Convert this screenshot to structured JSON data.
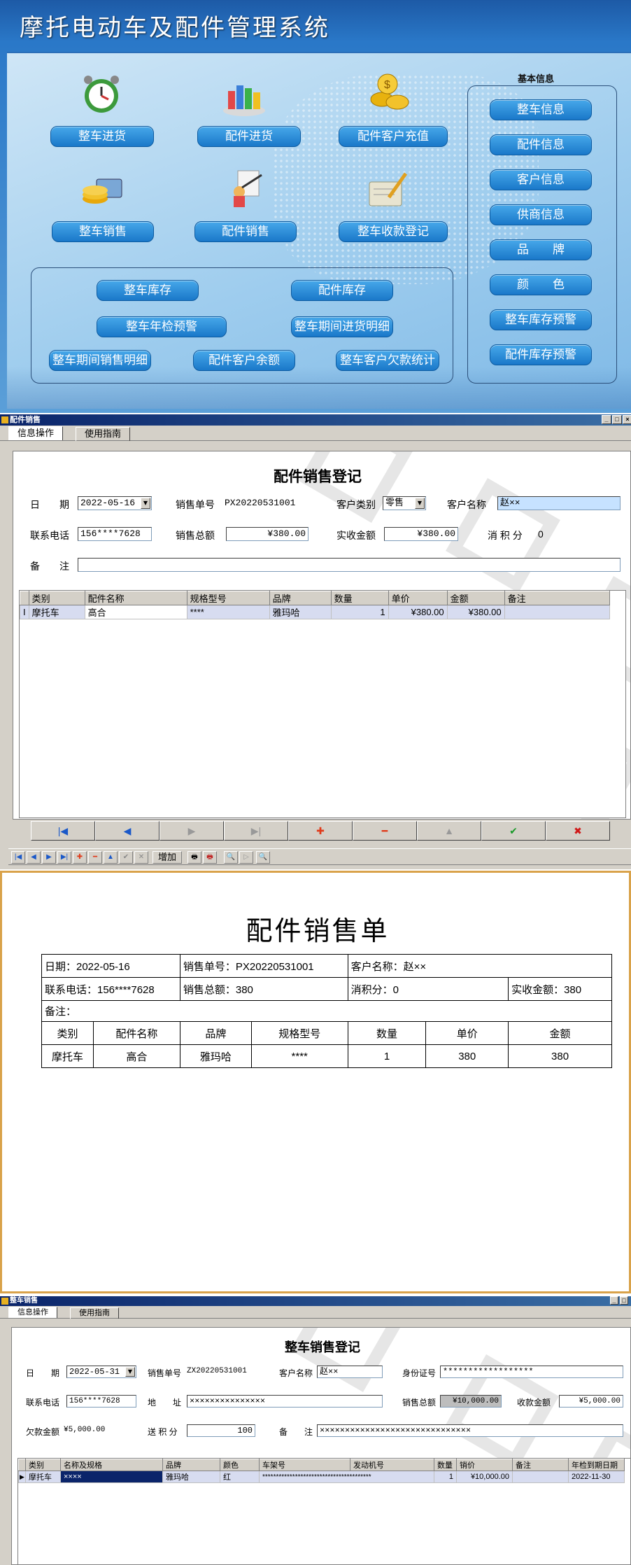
{
  "main": {
    "title": "摩托电动车及配件管理系统",
    "buttons": {
      "vehicle_purchase": "整车进货",
      "parts_purchase": "配件进货",
      "parts_customer_topup": "配件客户充值",
      "vehicle_sales": "整车销售",
      "parts_sales": "配件销售",
      "vehicle_payment": "整车收款登记",
      "vehicle_stock": "整车库存",
      "parts_stock": "配件库存",
      "vehicle_inspection_alert": "整车年检预警",
      "vehicle_period_purchase": "整车期间进货明细",
      "vehicle_period_sales": "整车期间销售明细",
      "parts_customer_balance": "配件客户余额",
      "vehicle_customer_debt": "整车客户欠款统计"
    },
    "basic_info": {
      "title": "基本信息",
      "items": [
        "整车信息",
        "配件信息",
        "客户信息",
        "供商信息",
        "品　　牌",
        "颜　　色",
        "整车库存预警",
        "配件库存预警"
      ]
    }
  },
  "parts_window": {
    "title": "配件销售",
    "tabs": [
      "信息操作",
      "使用指南"
    ],
    "form_title": "配件销售登记",
    "labels": {
      "date": "日　　期",
      "sale_no": "销售单号",
      "customer_type": "客户类别",
      "customer_name": "客户名称",
      "phone": "联系电话",
      "total": "销售总额",
      "received": "实收金额",
      "points": "消 积 分",
      "remark": "备　　注"
    },
    "values": {
      "date": "2022-05-16",
      "sale_no": "PX20220531001",
      "customer_type": "零售",
      "customer_name": "赵××",
      "phone": "156****7628",
      "total": "¥380.00",
      "received": "¥380.00",
      "points": "0",
      "remark": ""
    },
    "grid_headers": [
      "类别",
      "配件名称",
      "规格型号",
      "品牌",
      "数量",
      "单价",
      "金额",
      "备注"
    ],
    "grid_rows": [
      [
        "摩托车",
        "高合",
        "****",
        "雅玛哈",
        "1",
        "¥380.00",
        "¥380.00",
        ""
      ]
    ],
    "row_indicator": "I",
    "nav_icons": [
      "first-icon",
      "prior-icon",
      "next-icon",
      "last-icon",
      "insert-icon",
      "delete-icon",
      "edit-icon",
      "post-icon",
      "cancel-icon"
    ],
    "toolbar_add": "增加"
  },
  "report": {
    "title": "配件销售单",
    "date": "日期：2022-05-16",
    "sale_no": "销售单号：PX20220531001",
    "customer": "客户名称：赵××",
    "phone": "联系电话：156****7628",
    "total": "销售总额：380",
    "points": "消积分：0",
    "received": "实收金额：380",
    "remark": "备注：",
    "headers": [
      "类别",
      "配件名称",
      "品牌",
      "规格型号",
      "数量",
      "单价",
      "金额"
    ],
    "row": [
      "摩托车",
      "高合",
      "雅玛哈",
      "****",
      "1",
      "380",
      "380"
    ]
  },
  "vehicle_window": {
    "title": "整车销售",
    "tabs": [
      "信息操作",
      "使用指南"
    ],
    "form_title": "整车销售登记",
    "labels": {
      "date": "日　　期",
      "sale_no": "销售单号",
      "customer_name": "客户名称",
      "id_no": "身份证号",
      "phone": "联系电话",
      "address": "地　　址",
      "total": "销售总额",
      "received": "收款金额",
      "debt": "欠款金额",
      "points": "送 积 分",
      "remark": "备　　注"
    },
    "values": {
      "date": "2022-05-31",
      "sale_no": "ZX20220531001",
      "customer_name": "赵××",
      "id_no": "******************",
      "phone": "156****7628",
      "address": "×××××××××××××××",
      "total": "¥10,000.00",
      "received": "¥5,000.00",
      "debt": "¥5,000.00",
      "points": "100",
      "remark": "××××××××××××××××××××××××××××××"
    },
    "grid_headers": [
      "类别",
      "名称及规格",
      "品牌",
      "颜色",
      "车架号",
      "发动机号",
      "数量",
      "销价",
      "备注",
      "年检到期日期"
    ],
    "grid_rows": [
      [
        "摩托车",
        "××××",
        "雅玛哈",
        "红",
        "****************************************",
        "",
        "1",
        "¥10,000.00",
        "",
        "2022-11-30"
      ]
    ]
  },
  "colors": {
    "accent": "#1a78c9",
    "title_bar": "#0a246a",
    "report_border": "#d9a24a"
  }
}
